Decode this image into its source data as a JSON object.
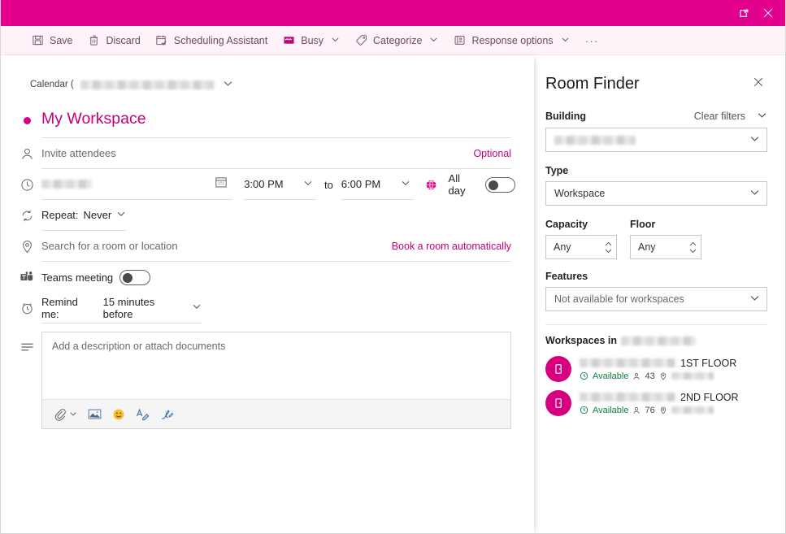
{
  "window": {
    "popout_label": "Open in new window",
    "close_label": "Close"
  },
  "toolbar": {
    "save": "Save",
    "discard": "Discard",
    "scheduling_assistant": "Scheduling Assistant",
    "busy": "Busy",
    "categorize": "Categorize",
    "response_options": "Response options",
    "overflow": "···"
  },
  "form": {
    "calendar_label": "Calendar (",
    "calendar_value_redacted": true,
    "title": "My Workspace",
    "attendees_placeholder": "Invite attendees",
    "optional_link": "Optional",
    "date_value_redacted": true,
    "start_time": "3:00 PM",
    "to_label": "to",
    "end_time": "6:00 PM",
    "all_day_label": "All day",
    "all_day_on": false,
    "repeat_label": "Repeat:",
    "repeat_value": "Never",
    "location_placeholder": "Search for a room or location",
    "book_room_link": "Book a room automatically",
    "teams_meeting_label": "Teams meeting",
    "teams_meeting_on": false,
    "remind_label": "Remind me:",
    "remind_value": "15 minutes before",
    "description_placeholder": "Add a description or attach documents",
    "description_tools": [
      {
        "name": "attach-icon",
        "label": "Attach"
      },
      {
        "name": "image-icon",
        "label": "Insert picture"
      },
      {
        "name": "emoji-icon",
        "label": "Emoji"
      },
      {
        "name": "format-text-icon",
        "label": "Format text"
      },
      {
        "name": "signature-icon",
        "label": "Signature"
      }
    ]
  },
  "room_finder": {
    "title": "Room Finder",
    "building_label": "Building",
    "clear_filters": "Clear filters",
    "building_value_redacted": true,
    "type_label": "Type",
    "type_value": "Workspace",
    "capacity_label": "Capacity",
    "capacity_value": "Any",
    "floor_label": "Floor",
    "floor_value": "Any",
    "features_label": "Features",
    "features_value": "Not available for workspaces",
    "workspaces_heading": "Workspaces in",
    "workspaces_heading_value_redacted": true,
    "workspaces": [
      {
        "name_suffix": "1ST FLOOR",
        "status": "Available",
        "capacity": "43",
        "name_redacted": true,
        "location_redacted": true
      },
      {
        "name_suffix": "2ND FLOOR",
        "status": "Available",
        "capacity": "76",
        "name_redacted": true,
        "location_redacted": true
      }
    ]
  },
  "colors": {
    "accent": "#E3008C",
    "accent_dark": "#C4007A",
    "toolbar_bg": "#FDF3F9",
    "available_green": "#107C41"
  }
}
